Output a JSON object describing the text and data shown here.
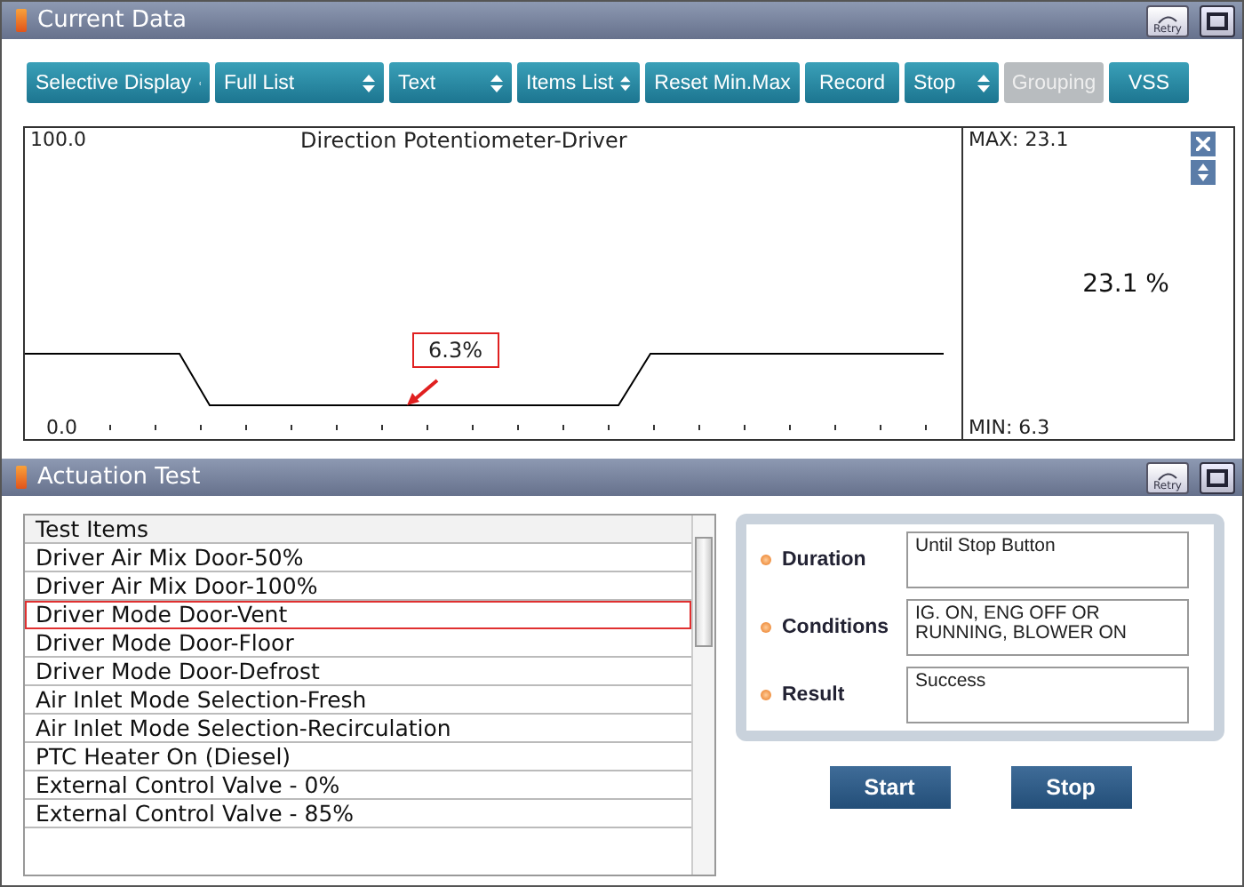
{
  "current_data": {
    "title": "Current Data",
    "retry_label": "Retry",
    "toolbar": [
      {
        "label": "Selective Display",
        "kind": "dropdown",
        "disabled": false
      },
      {
        "label": "Full List",
        "kind": "dropdown",
        "disabled": false
      },
      {
        "label": "Text",
        "kind": "dropdown",
        "disabled": false
      },
      {
        "label": "Items List",
        "kind": "dropdown",
        "disabled": false
      },
      {
        "label": "Reset Min.Max",
        "kind": "button",
        "disabled": false
      },
      {
        "label": "Record",
        "kind": "button",
        "disabled": false
      },
      {
        "label": "Stop",
        "kind": "dropdown",
        "disabled": false
      },
      {
        "label": "Grouping",
        "kind": "button",
        "disabled": true
      },
      {
        "label": "VSS",
        "kind": "button",
        "disabled": false
      }
    ],
    "graph": {
      "title": "Direction Potentiometer-Driver",
      "max_label": "100.0",
      "min_label": "0.0",
      "annotation": "6.3%",
      "max_reading": "MAX: 23.1",
      "min_reading": "MIN: 6.3",
      "current_value": "23.1 %"
    }
  },
  "actuation_test": {
    "title": "Actuation Test",
    "retry_label": "Retry",
    "list_header": "Test Items",
    "items": [
      {
        "label": "Driver Air Mix Door-50%",
        "selected": false
      },
      {
        "label": "Driver Air Mix Door-100%",
        "selected": false
      },
      {
        "label": "Driver Mode Door-Vent",
        "selected": true
      },
      {
        "label": "Driver Mode Door-Floor",
        "selected": false
      },
      {
        "label": "Driver Mode Door-Defrost",
        "selected": false
      },
      {
        "label": "Air Inlet Mode Selection-Fresh",
        "selected": false
      },
      {
        "label": "Air Inlet Mode Selection-Recirculation",
        "selected": false
      },
      {
        "label": "PTC Heater On (Diesel)",
        "selected": false
      },
      {
        "label": "External Control Valve - 0%",
        "selected": false
      },
      {
        "label": "External Control Valve - 85%",
        "selected": false
      }
    ],
    "details": [
      {
        "label": "Duration",
        "value": "Until Stop Button"
      },
      {
        "label": "Conditions",
        "value": "IG. ON, ENG OFF OR RUNNING, BLOWER ON"
      },
      {
        "label": "Result",
        "value": "Success"
      }
    ],
    "buttons": [
      "Start",
      "Stop"
    ]
  }
}
